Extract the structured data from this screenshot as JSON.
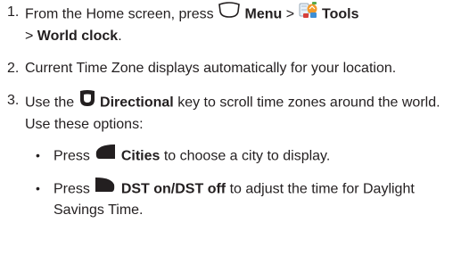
{
  "steps": [
    {
      "num": "1.",
      "prefix": "From the Home screen, press",
      "menu_label": "Menu",
      "sep1": ">",
      "tools_label": "Tools",
      "sep2": ">",
      "world_clock_label": "World clock",
      "end": "."
    },
    {
      "num": "2.",
      "text": "Current Time Zone displays automatically for your location."
    },
    {
      "num": "3.",
      "prefix": "Use the",
      "directional_label": "Directional",
      "suffix": "key to scroll time zones around the world. Use these options:"
    }
  ],
  "bullets": [
    {
      "marker": "•",
      "press": "Press",
      "key_label": "Cities",
      "rest": "to choose a city to display."
    },
    {
      "marker": "•",
      "press": "Press",
      "key_label": "DST on/DST off",
      "rest": "to adjust the time for Daylight Savings Time."
    }
  ],
  "icons": {
    "menu_key": "menu-key-icon",
    "tools_app": "tools-app-icon",
    "directional_key": "directional-key-icon",
    "left_softkey": "left-softkey-icon",
    "right_softkey": "right-softkey-icon"
  },
  "colors": {
    "text": "#231f20",
    "key_fill": "#231f20"
  }
}
